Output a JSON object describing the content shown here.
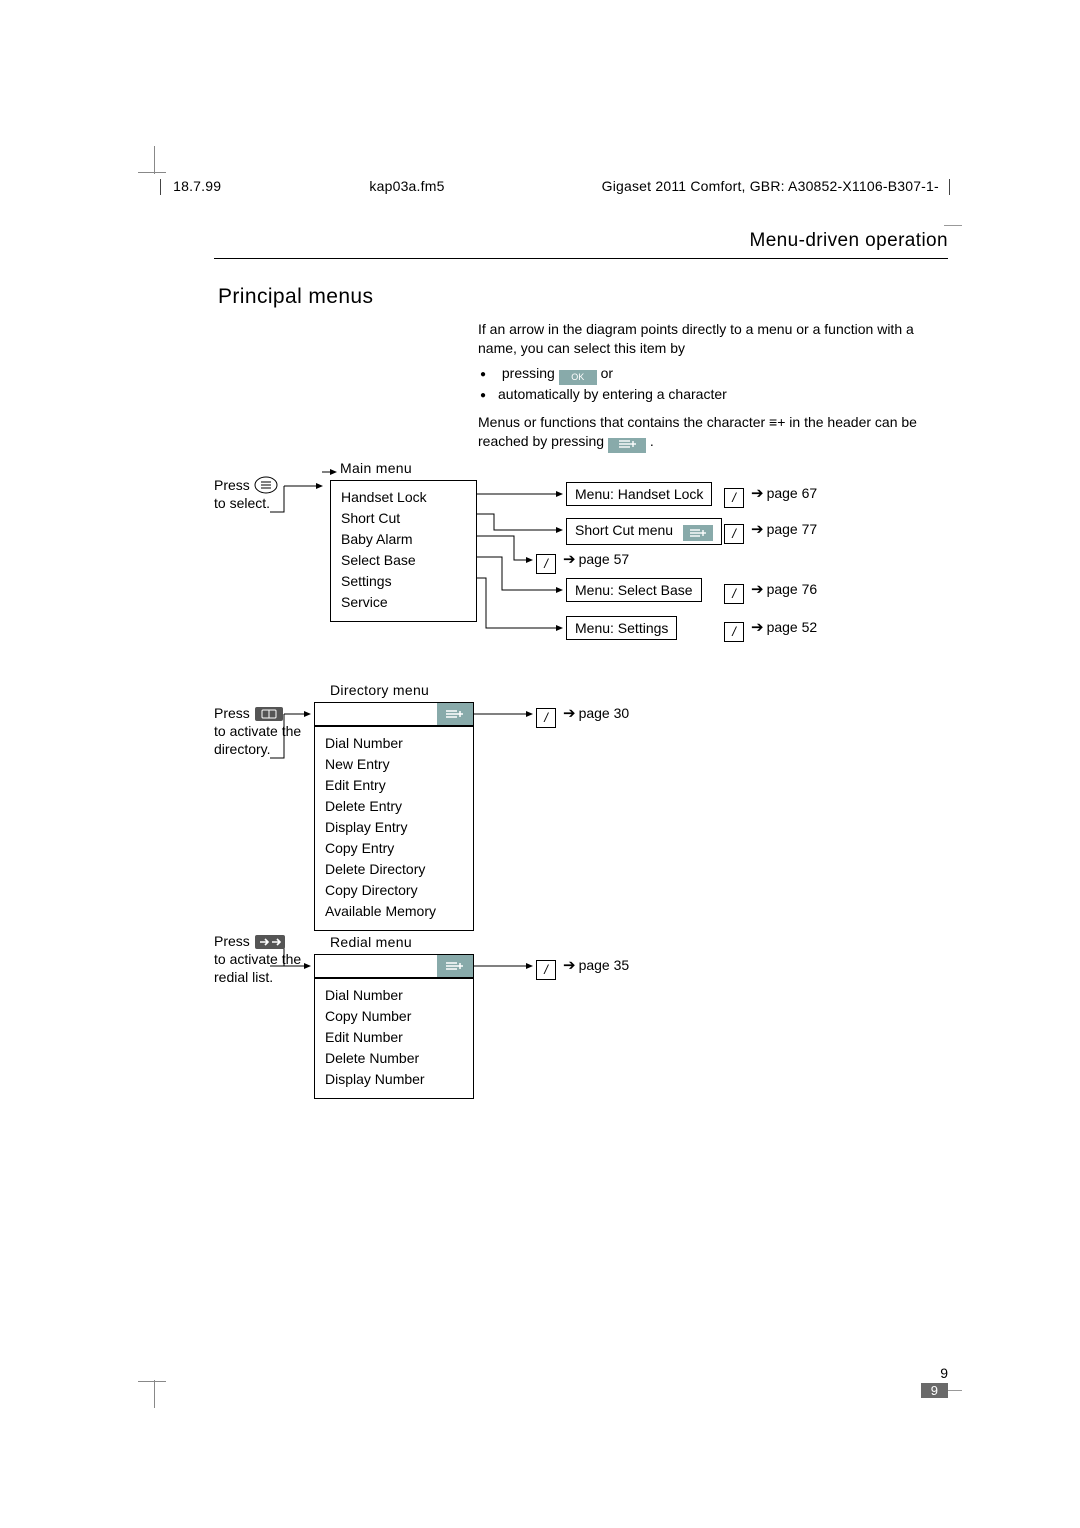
{
  "meta": {
    "date": "18.7.99",
    "file": "kap03a.fm5",
    "doc_title": "Gigaset 2011 Comfort, GBR: A30852-X1106-B307-1-"
  },
  "section_title": "Menu-driven operation",
  "section_heading": "Principal menus",
  "intro": {
    "para1": "If an arrow in the diagram points directly to a menu or a function with a name, you can select this item by",
    "bullet1_pre": "pressing ",
    "bullet1_key": "OK",
    "bullet1_post": " or",
    "bullet2": "automatically by entering a character",
    "para2_pre": "Menus or functions that contains the character ",
    "para2_sym": "≡+",
    "para2_mid": " in the header can be reached by pressing ",
    "para2_key": "≡+",
    "para2_end": "."
  },
  "press": {
    "menu_line1": "Press",
    "menu_line2": "to select.",
    "dir_line1": "Press",
    "dir_line2": "to activate the",
    "dir_line3": "directory.",
    "redial_line1": "Press",
    "redial_line2": "to activate the",
    "redial_line3": "redial list."
  },
  "menus": {
    "main": {
      "title": "Main menu",
      "items": [
        "Handset Lock",
        "Short Cut",
        "Baby Alarm",
        "Select Base",
        "Settings",
        "Service"
      ]
    },
    "directory": {
      "title": "Directory menu",
      "items": [
        "Dial Number",
        "New Entry",
        "Edit Entry",
        "Delete Entry",
        "Display Entry",
        "Copy Entry",
        "Delete Directory",
        "Copy Directory",
        "Available Memory"
      ]
    },
    "redial": {
      "title": "Redial menu",
      "items": [
        "Dial Number",
        "Copy Number",
        "Edit Number",
        "Delete Number",
        "Display Number"
      ]
    }
  },
  "results": {
    "handset_lock": "Menu: Handset Lock",
    "short_cut": "Short Cut menu",
    "select_base": "Menu: Select Base",
    "settings": "Menu: Settings"
  },
  "page_refs": {
    "p67": "page 67",
    "p77": "page 77",
    "p57": "page 57",
    "p76": "page 76",
    "p52": "page 52",
    "p30": "page 30",
    "p35": "page 35",
    "arrow": "➔"
  },
  "page_number": "9"
}
